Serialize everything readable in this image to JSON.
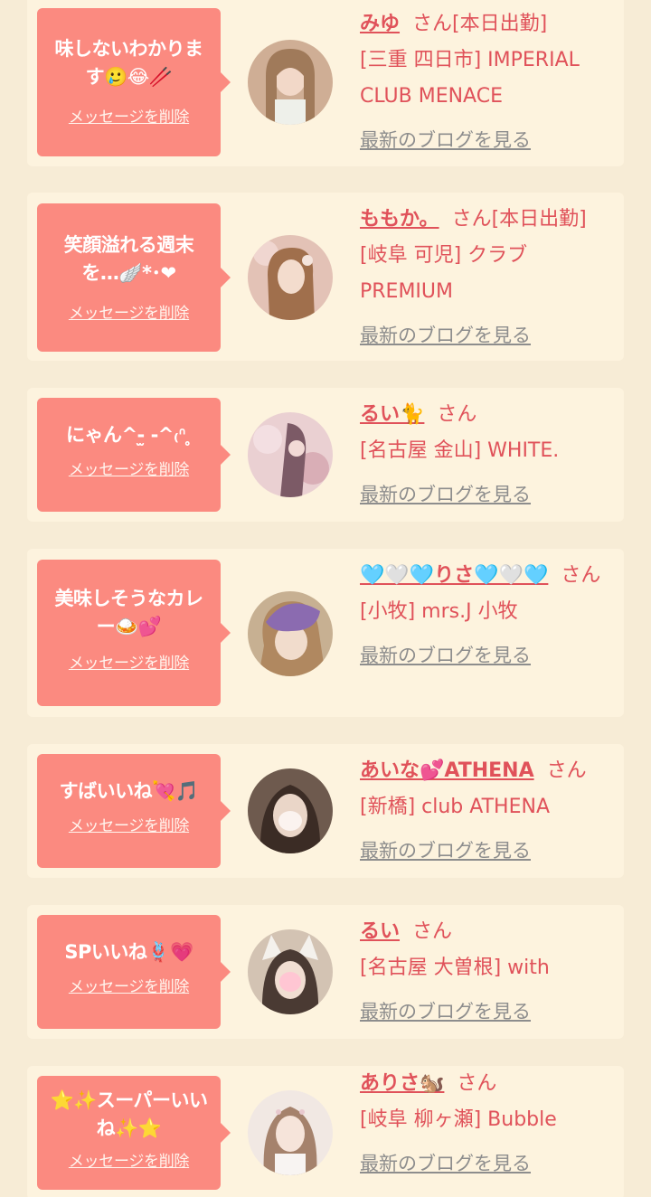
{
  "items": [
    {
      "message": "味しないわかります🥲😂🥢",
      "delete_label": "メッセージを削除",
      "name": "みゆ",
      "san": "さん[本日出勤]",
      "shop": "[三重 四日市] IMPERIAL CLUB MENACE",
      "blog_label": "最新のブログを見る",
      "avatar_color": "#d9b9a0"
    },
    {
      "message": "笑顔溢れる週末を…🪽*･❤",
      "delete_label": "メッセージを削除",
      "name": "ももか。",
      "san": "さん[本日出勤]",
      "shop": "[岐阜 可児] クラブPREMIUM",
      "blog_label": "最新のブログを見る",
      "avatar_color": "#c8a089"
    },
    {
      "message": "にゃん^-̫ -^₍ᐢ ̥",
      "delete_label": "メッセージを削除",
      "name": "るい🐈",
      "san": "さん",
      "shop": "[名古屋 金山] WHITE.",
      "blog_label": "最新のブログを見る",
      "avatar_color": "#e7c3c4"
    },
    {
      "message": "美味しそうなカレー🍛💕",
      "delete_label": "メッセージを削除",
      "name": "🩵🤍🩵りさ🩵🤍🩵",
      "san": "さん",
      "shop": "[小牧] mrs.J 小牧",
      "blog_label": "最新のブログを見る",
      "avatar_color": "#9b86b8"
    },
    {
      "message": "すばいいね💘🎵",
      "delete_label": "メッセージを削除",
      "name": "あいな💕ATHENA",
      "san": "さん",
      "shop": "[新橋] club ATHENA",
      "blog_label": "最新のブログを見る",
      "avatar_color": "#6b5548"
    },
    {
      "message": "SPいいね🪢💗",
      "delete_label": "メッセージを削除",
      "name": "るい",
      "san": "さん",
      "shop": "[名古屋 大曽根] with",
      "blog_label": "最新のブログを見る",
      "avatar_color": "#d8cabc"
    },
    {
      "message": "⭐✨スーパーいいね✨⭐",
      "delete_label": "メッセージを削除",
      "name": "ありさ🐿️",
      "san": "さん",
      "shop": "[岐阜 柳ヶ瀬] Bubble",
      "blog_label": "最新のブログを見る",
      "avatar_color": "#e8dcd6"
    }
  ]
}
